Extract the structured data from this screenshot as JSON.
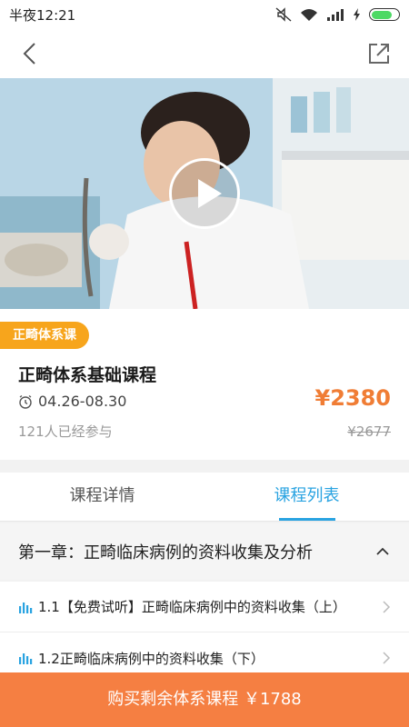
{
  "status_bar": {
    "time": "半夜12:21"
  },
  "course": {
    "tag": "正畸体系课",
    "title": "正畸体系基础课程",
    "date_range": "04.26-08.30",
    "participants": "121人已经参与",
    "price": "¥2380",
    "original_price": "¥2677"
  },
  "tabs": [
    {
      "label": "课程详情",
      "active": false
    },
    {
      "label": "课程列表",
      "active": true
    }
  ],
  "chapter": {
    "title": "第一章：正畸临床病例的资料收集及分析"
  },
  "lessons": [
    {
      "title": "1.1【免费试听】正畸临床病例中的资料收集（上）"
    },
    {
      "title": "1.2正畸临床病例中的资料收集（下）"
    }
  ],
  "buy_button": {
    "label": "购买剩余体系课程 ￥1788"
  },
  "colors": {
    "accent_blue": "#29a3e1",
    "price_orange": "#f07d35",
    "tag_orange": "#f7a51c",
    "buy_bar": "#f57f42"
  },
  "icons": [
    "back-arrow-icon",
    "share-icon",
    "play-icon",
    "clock-icon",
    "audio-bars-icon",
    "chevron-up-icon",
    "chevron-right-icon",
    "mute-icon",
    "wifi-icon",
    "signal-icon",
    "charging-icon",
    "battery-icon"
  ]
}
